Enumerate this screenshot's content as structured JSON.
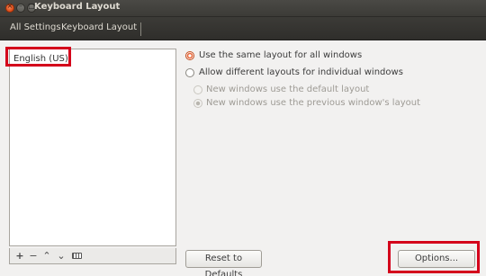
{
  "window": {
    "title": "Keyboard Layout",
    "close_glyph": "×",
    "min_glyph": "–",
    "max_glyph": "□"
  },
  "breadcrumb": {
    "all_settings": "All Settings",
    "current": "Keyboard Layout"
  },
  "layouts": {
    "items": [
      "English (US)"
    ]
  },
  "list_toolbar": {
    "add": "+",
    "remove": "−",
    "up": "⌃",
    "down": "⌄",
    "keyboard_icon": "keyboard-icon"
  },
  "options": {
    "same_layout": "Use the same layout for all windows",
    "different_layouts": "Allow different layouts for individual windows",
    "new_default": "New windows use the default layout",
    "new_previous": "New windows use the previous window's layout",
    "selected": "same_layout"
  },
  "buttons": {
    "reset": "Reset to Defaults",
    "options": "Options..."
  },
  "colors": {
    "highlight_box": "#d4001b",
    "radio_accent": "#e8673a"
  }
}
